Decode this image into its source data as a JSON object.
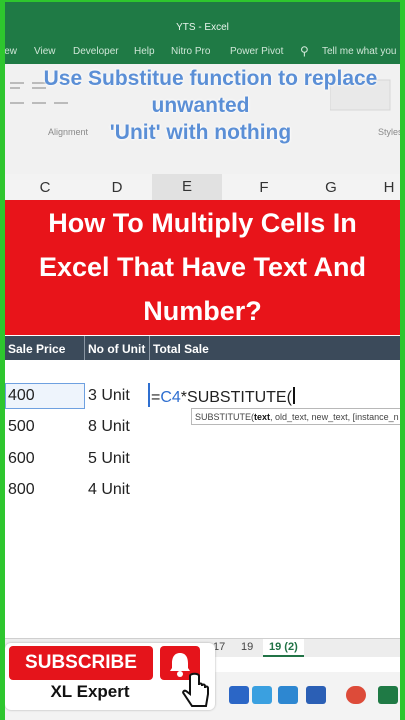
{
  "app": {
    "title": "YTS  -  Excel"
  },
  "menu": {
    "items": [
      "iew",
      "View",
      "Developer",
      "Help",
      "Nitro Pro",
      "Power Pivot"
    ],
    "tell_me": "Tell me what you"
  },
  "ribbon": {
    "groups": [
      "Alignment",
      "Styles"
    ]
  },
  "overlay": {
    "lines": [
      "Use Substitue function to replace",
      "unwanted",
      "'Unit' with nothing"
    ]
  },
  "columns": [
    "C",
    "D",
    "E",
    "F",
    "G",
    "H"
  ],
  "banner": {
    "lines": [
      "How To Multiply Cells In",
      "Excel That Have Text And",
      "Number?"
    ]
  },
  "table": {
    "headers": [
      "Sale Price",
      "No of Unit",
      "Total Sale"
    ],
    "rows": [
      {
        "price": "400",
        "units": "3 Unit"
      },
      {
        "price": "500",
        "units": "8 Unit"
      },
      {
        "price": "600",
        "units": "5 Unit"
      },
      {
        "price": "800",
        "units": "4 Unit"
      }
    ]
  },
  "formula": {
    "eq": "=",
    "ref": "C4",
    "rest": "*SUBSTITUTE("
  },
  "tooltip": {
    "fn": "SUBSTITUTE(",
    "arg1": "text",
    "rest": ", old_text, new_text, [instance_n"
  },
  "sheets": {
    "tab_a": "17",
    "tab_b": "19",
    "tab_active": "19 (2)"
  },
  "promo": {
    "subscribe": "SUBSCRIBE",
    "channel": "XL Expert"
  },
  "colors": {
    "excel_green": "#1f7a45",
    "banner_red": "#e8141a",
    "frame_green": "#2ec62e"
  }
}
